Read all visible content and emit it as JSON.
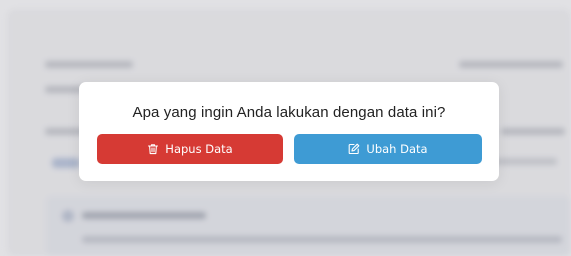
{
  "dialog": {
    "title": "Apa yang ingin Anda lakukan dengan data ini?",
    "delete_button": {
      "label": "Hapus Data",
      "icon": "trash-icon",
      "color": "#d63a34"
    },
    "edit_button": {
      "label": "Ubah Data",
      "icon": "edit-icon",
      "color": "#3e9bd4"
    }
  }
}
